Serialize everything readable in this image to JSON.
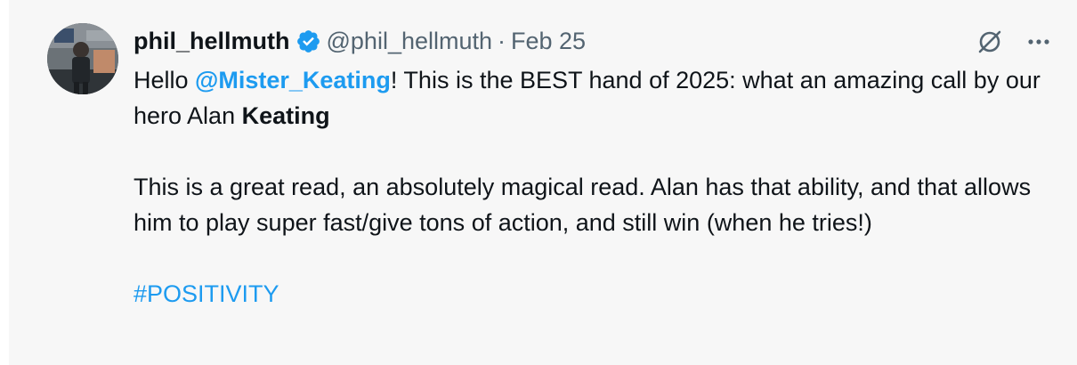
{
  "tweet": {
    "author": {
      "display_name": "phil_hellmuth",
      "handle": "@phil_hellmuth",
      "verified": true
    },
    "separator": "·",
    "date": "Feb 25",
    "body": {
      "line1_prefix": "Hello ",
      "mention": "@Mister_Keating",
      "line1_suffix": "! This is the BEST hand of 2025: what an amazing call by our hero Alan ",
      "bold_word": "Keating",
      "paragraph2": "This is a great read, an absolutely magical read. Alan has that ability, and that allows him to play super fast/give tons of action, and still win (when he tries!)",
      "hashtag": "#POSITIVITY"
    },
    "icons": {
      "verified": "verified-badge-icon",
      "grok": "grok-icon",
      "more": "more-icon"
    }
  },
  "colors": {
    "background": "#f7f7f7",
    "text": "#0f1419",
    "secondary_text": "#536471",
    "accent": "#1d9bf0"
  }
}
